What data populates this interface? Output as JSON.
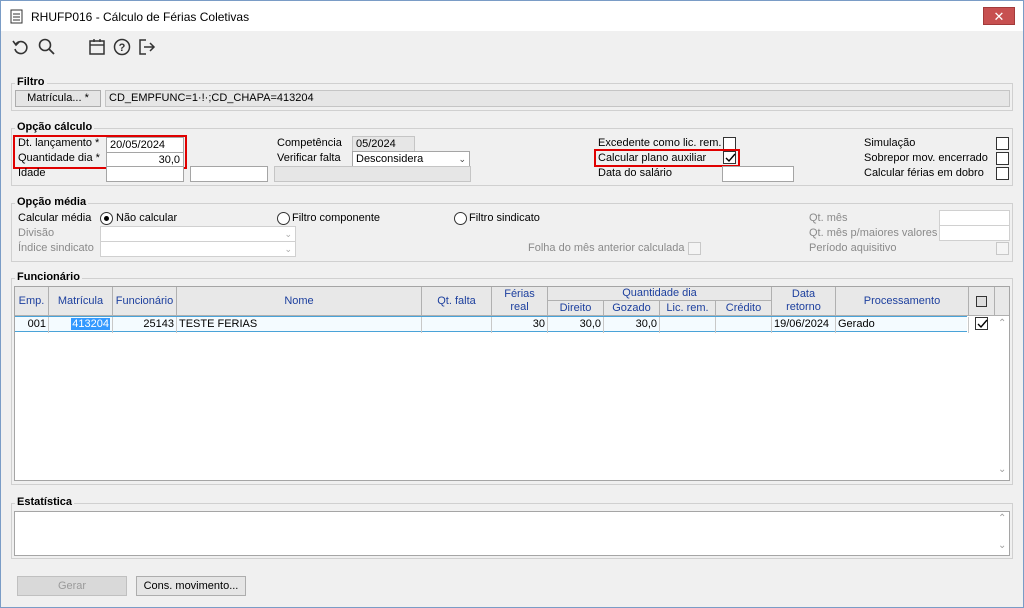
{
  "window": {
    "title": "RHUFP016 - Cálculo de Férias Coletivas",
    "close_label": "✕"
  },
  "toolbar": {
    "icons": [
      "undo-icon",
      "search-icon",
      "calendar-icon",
      "help-icon",
      "exit-icon"
    ]
  },
  "filtro": {
    "legend": "Filtro",
    "matricula_button": "Matrícula... *",
    "filter_value": "CD_EMPFUNC=1·!·;CD_CHAPA=413204"
  },
  "opcao_calculo": {
    "legend": "Opção cálculo",
    "dt_lancamento_label": "Dt. lançamento *",
    "dt_lancamento_value": "20/05/2024",
    "quantidade_dia_label": "Quantidade dia *",
    "quantidade_dia_value": "30,0",
    "idade_label": "Idade",
    "idade_value": "",
    "idade_value2": "",
    "competencia_label": "Competência",
    "competencia_value": "05/2024",
    "verificar_falta_label": "Verificar falta",
    "verificar_falta_value": "Desconsidera",
    "excedente_label": "Excedente como lic. rem.",
    "calcular_plano_label": "Calcular plano auxiliar",
    "data_salario_label": "Data do salário",
    "data_salario_value": "",
    "simulacao_label": "Simulação",
    "sobrepor_label": "Sobrepor mov. encerrado",
    "calcular_dobro_label": "Calcular férias em dobro",
    "excedente_checked": false,
    "calcular_plano_checked": true,
    "simulacao_checked": false,
    "sobrepor_checked": false,
    "calcular_dobro_checked": false
  },
  "opcao_media": {
    "legend": "Opção média",
    "calcular_media_label": "Calcular média",
    "radio_nao_calcular": "Não calcular",
    "radio_filtro_componente": "Filtro componente",
    "radio_filtro_sindicato": "Filtro sindicato",
    "selected_radio": "Não calcular",
    "divisao_label": "Divisão",
    "indice_sindicato_label": "Índice sindicato",
    "folha_label": "Folha do mês anterior calculada",
    "qt_mes_label": "Qt. mês",
    "qt_mes_maiores_label": "Qt. mês p/maiores valores",
    "periodo_aquisitivo_label": "Período aquisitivo"
  },
  "funcionario": {
    "legend": "Funcionário",
    "headers": {
      "emp": "Emp.",
      "matricula": "Matrícula",
      "funcionario": "Funcionário",
      "nome": "Nome",
      "qt_falta": "Qt. falta",
      "ferias_real": "Férias real",
      "quantidade_dia": "Quantidade dia",
      "direito": "Direito",
      "gozado": "Gozado",
      "lic_rem": "Lic. rem.",
      "credito": "Crédito",
      "data_retorno": "Data retorno",
      "processamento": "Processamento"
    },
    "rows": [
      {
        "emp": "001",
        "matricula": "413204",
        "funcionario": "25143",
        "nome": "TESTE FERIAS",
        "qt_falta": "",
        "ferias_real": "30",
        "direito": "30,0",
        "gozado": "30,0",
        "lic_rem": "",
        "credito": "",
        "data_retorno": "19/06/2024",
        "processamento": "Gerado",
        "checked": true
      }
    ]
  },
  "estatistica": {
    "legend": "Estatística"
  },
  "footer": {
    "gerar_label": "Gerar",
    "cons_movimento_label": "Cons. movimento..."
  }
}
